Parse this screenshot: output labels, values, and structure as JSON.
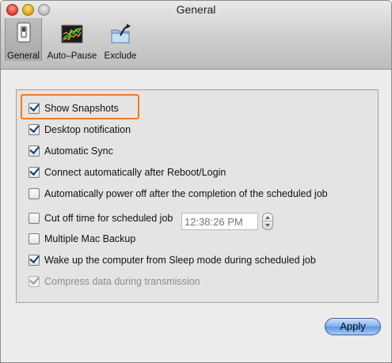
{
  "window": {
    "title": "General"
  },
  "toolbar": {
    "items": [
      {
        "label": "General",
        "icon": "switch-icon",
        "selected": true
      },
      {
        "label": "Auto–Pause",
        "icon": "chart-icon",
        "selected": false
      },
      {
        "label": "Exclude",
        "icon": "folder-arrow-icon",
        "selected": false
      }
    ]
  },
  "settings": {
    "options": [
      {
        "label": "Show Snapshots",
        "checked": true,
        "enabled": true
      },
      {
        "label": "Desktop notification",
        "checked": true,
        "enabled": true
      },
      {
        "label": "Automatic Sync",
        "checked": true,
        "enabled": true
      },
      {
        "label": "Connect automatically after Reboot/Login",
        "checked": true,
        "enabled": true
      },
      {
        "label": "Automatically power off after the completion of the scheduled job",
        "checked": false,
        "enabled": true
      },
      {
        "label": "Cut off time for scheduled job",
        "checked": false,
        "enabled": true
      },
      {
        "label": "Multiple Mac Backup",
        "checked": false,
        "enabled": true
      },
      {
        "label": "Wake up the computer from Sleep mode during scheduled job",
        "checked": true,
        "enabled": true
      },
      {
        "label": "Compress data during transmission",
        "checked": true,
        "enabled": false
      }
    ],
    "cutoff_time": "12:38:26  PM"
  },
  "buttons": {
    "apply": "Apply"
  },
  "colors": {
    "highlight": "#f07a1f",
    "apply_button": "#7fb0ee",
    "checkmark": "#13337c"
  }
}
